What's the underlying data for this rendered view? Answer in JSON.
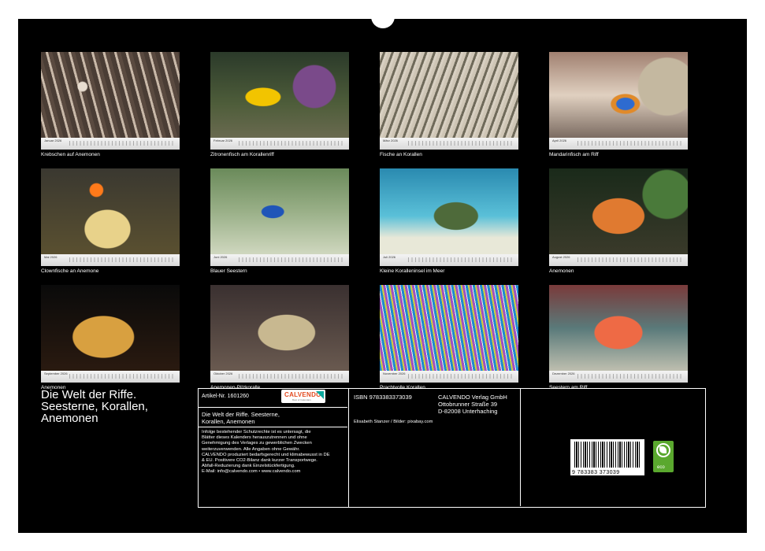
{
  "tiles": [
    {
      "month": "Januar 2026",
      "caption": "Krebschen auf Anemonen"
    },
    {
      "month": "Februar 2026",
      "caption": "Zitronenfisch am Korallenriff"
    },
    {
      "month": "März 2026",
      "caption": "Fische an Korallen"
    },
    {
      "month": "April 2026",
      "caption": "Mandarinfisch am Riff"
    },
    {
      "month": "Mai 2026",
      "caption": "Clownfische an Anemone"
    },
    {
      "month": "Juni 2026",
      "caption": "Blauer Seestern"
    },
    {
      "month": "Juli 2026",
      "caption": "Kleine Koralleninsel im Meer"
    },
    {
      "month": "August 2026",
      "caption": "Anemonen"
    },
    {
      "month": "September 2026",
      "caption": "Anemonen"
    },
    {
      "month": "Oktober 2026",
      "caption": "Anemonen-Pilzkoralle"
    },
    {
      "month": "November 2026",
      "caption": "Prachtvolle Korallen"
    },
    {
      "month": "Dezember 2026",
      "caption": "Seestern am Riff"
    }
  ],
  "calendar": {
    "title_line1": "Die Welt der Riffe.",
    "title_line2": "Seesterne, Korallen,",
    "title_line3": "Anemonen"
  },
  "info": {
    "article_no": "Artikel-Nr. 1601260",
    "logo": "CALVENDO",
    "logo_sub": "Best of Calendars",
    "title_line1": "Die Welt der Riffe. Seesterne,",
    "title_line2": "Korallen, Anemonen",
    "notice": [
      "Infolge bestehender Schutzrechte ist es untersagt, die",
      "Blätter dieses Kalenders herauszutrennen und ohne",
      "Genehmigung des Verlages zu gewerblichen Zwecken",
      "weiterzuverwenden. Alle Angaben ohne Gewähr.",
      "CALVENDO produziert bedarfsgerecht und klimabewusst in DE",
      "& EU. Positivere CO2-Bilanz dank kurzer Transportwege.",
      "Abfall-Reduzierung dank Einzelstückfertigung.",
      "E-Mail: info@calvendo.com • www.calvendo.com"
    ],
    "isbn": "ISBN 9783383373039",
    "publisher": "CALVENDO Verlag GmbH",
    "street": "Ottobrunner Straße 39",
    "city": "D-82008 Unterhaching",
    "credits": "Elisabeth Stanzer / Bilder: pixabay.com",
    "barcode_number": "9 783383 373039",
    "eco_label": "eco"
  }
}
